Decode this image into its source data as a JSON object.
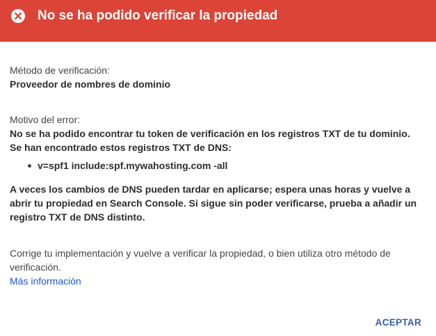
{
  "header": {
    "title": "No se ha podido verificar la propiedad",
    "icon": "error-circle-x-icon",
    "background_color": "#db4437"
  },
  "method": {
    "label": "Método de verificación:",
    "value": "Proveedor de nombres de dominio"
  },
  "error": {
    "label": "Motivo del error:",
    "line1": "No se ha podido encontrar tu token de verificación en los registros TXT de tu dominio.",
    "line2": "Se han encontrado estos registros TXT de DNS:",
    "records": [
      "v=spf1 include:spf.mywahosting.com -all"
    ],
    "note": "A veces los cambios de DNS pueden tardar en aplicarse; espera unas horas y vuelve a abrir tu propiedad en Search Console. Si sigue sin poder verificarse, prueba a añadir un registro TXT de DNS distinto."
  },
  "footer": {
    "instructions": "Corrige tu implementación y vuelve a verificar la propiedad, o bien utiliza otro método de verificación.",
    "more_info_link": "Más información",
    "accept_button": "ACEPTAR"
  }
}
